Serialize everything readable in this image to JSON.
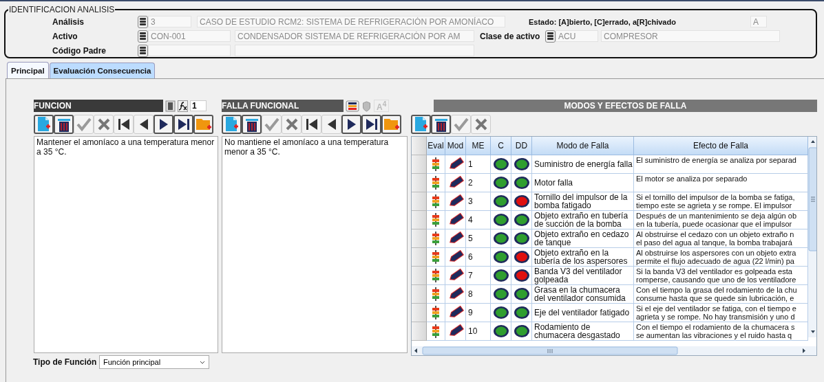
{
  "identificacion": {
    "title": "IDENTIFICACION ANALISIS",
    "analisis": {
      "label": "Análisis",
      "code": "3",
      "description": "CASO DE ESTUDIO RCM2: SISTEMA DE REFRIGERACIÓN POR AMONÍACO"
    },
    "estado": {
      "label": "Estado: [A]bierto, [C]errado, a[R]chivado",
      "value": "A"
    },
    "activo": {
      "label": "Activo",
      "code": "CON-001",
      "description": "CONDENSADOR SISTEMA DE REFRIGERACIÓN POR AM"
    },
    "clase_activo": {
      "label": "Clase de activo",
      "code": "ACU",
      "description": "COMPRESOR"
    },
    "codigo_padre": {
      "label": "Código Padre"
    }
  },
  "tabs": [
    {
      "label": "Principal",
      "selected": true
    },
    {
      "label": "Evaluación Consecuencia",
      "selected": false
    }
  ],
  "funcion": {
    "title": "FUNCION",
    "number": "1",
    "text": "Mantener el amoníaco a una temperatura menor a 35 °C.",
    "toolbar": [
      {
        "kind": "new",
        "disabled": false
      },
      {
        "kind": "delete",
        "disabled": false
      },
      {
        "kind": "save",
        "disabled": true
      },
      {
        "kind": "cancel",
        "disabled": true
      },
      {
        "kind": "first",
        "disabled": true
      },
      {
        "kind": "prev",
        "disabled": true
      },
      {
        "kind": "next",
        "disabled": false
      },
      {
        "kind": "last",
        "disabled": false
      },
      {
        "kind": "folder",
        "disabled": false
      }
    ],
    "tipo_label": "Tipo de Función",
    "tipo_value": "Función principal"
  },
  "falla_funcional": {
    "title": "FALLA FUNCIONAL",
    "letter": "A$^{4}$",
    "text": "No mantiene el amoníaco a una temperatura menor a 35 °C.",
    "toolbar": [
      {
        "kind": "new",
        "disabled": false
      },
      {
        "kind": "delete",
        "disabled": false
      },
      {
        "kind": "save",
        "disabled": true
      },
      {
        "kind": "cancel",
        "disabled": true
      },
      {
        "kind": "first",
        "disabled": true
      },
      {
        "kind": "prev",
        "disabled": true
      },
      {
        "kind": "next",
        "disabled": false
      },
      {
        "kind": "last",
        "disabled": false
      },
      {
        "kind": "folder",
        "disabled": false
      }
    ]
  },
  "modos": {
    "title": "MODOS Y EFECTOS DE FALLA",
    "toolbar": [
      {
        "kind": "new",
        "disabled": false
      },
      {
        "kind": "delete",
        "disabled": false
      },
      {
        "kind": "save",
        "disabled": true
      },
      {
        "kind": "cancel",
        "disabled": true
      }
    ],
    "columns": [
      "Eval",
      "Mod",
      "ME",
      "C",
      "DD",
      "Modo de Falla",
      "Efecto de Falla"
    ],
    "rows": [
      {
        "me": "1",
        "c": {
          "color": "#2f9e2f"
        },
        "dd": {
          "color": "#2f9e2f"
        },
        "modo": "Suministro de energía falla",
        "efecto": [
          "El suministro de energía se analiza por separad"
        ]
      },
      {
        "me": "2",
        "c": {
          "color": "#2f9e2f"
        },
        "dd": {
          "color": "#2f9e2f"
        },
        "modo": "Motor falla",
        "efecto": [
          "El motor se analiza por separado"
        ]
      },
      {
        "me": "3",
        "c": {
          "color": "#2f9e2f"
        },
        "dd": {
          "color": "#e01010"
        },
        "modo": "Tornillo del impulsor de la bomba fatigado",
        "efecto": [
          "Si el tornillo del impulsor de la bomba se fatiga,",
          "tiempo este se agrieta y se rompe. El impulsor"
        ]
      },
      {
        "me": "4",
        "c": {
          "color": "#2f9e2f"
        },
        "dd": {
          "color": "#2f9e2f"
        },
        "modo": "Objeto extraño en tubería de succión de la bomba",
        "efecto": [
          "Después de un mantenimiento se deja algún ob",
          "en la tubería, puede ocasionar que el impulsor"
        ]
      },
      {
        "me": "5",
        "c": {
          "color": "#2f9e2f"
        },
        "dd": {
          "color": "#2f9e2f"
        },
        "modo": "Objeto extraño en cedazo de tanque",
        "efecto": [
          "Al obstruirse el cedazo con un objeto extraño n",
          "el paso del agua al tanque, la bomba trabajará"
        ]
      },
      {
        "me": "6",
        "c": {
          "color": "#2f9e2f"
        },
        "dd": {
          "color": "#e01010"
        },
        "modo": "Objeto extraño en la tubería de los aspersores",
        "efecto": [
          "Al obstruirse los aspersores con un objeto extra",
          "permite el flujo adecuado de agua (22 l/min) pa"
        ]
      },
      {
        "me": "7",
        "c": {
          "color": "#2f9e2f"
        },
        "dd": {
          "color": "#e01010"
        },
        "modo": "Banda V3 del ventilador golpeada",
        "efecto": [
          "Si la banda V3 del ventilador es golpeada esta",
          "romperse, causando que uno de los ventiladore"
        ]
      },
      {
        "me": "8",
        "c": {
          "color": "#2f9e2f"
        },
        "dd": {
          "color": "#2f9e2f"
        },
        "modo": "Grasa en la chumacera del ventilador consumida",
        "efecto": [
          "Con el tiempo la grasa del rodamiento de la chu",
          "consume hasta que se quede sin lubricación, e"
        ]
      },
      {
        "me": "9",
        "c": {
          "color": "#2f9e2f"
        },
        "dd": {
          "color": "#2f9e2f"
        },
        "modo": "Eje del ventilador fatigado",
        "efecto": [
          "Si el eje del ventilador se fatiga, con el tiempo e",
          "agrieta y se rompe. No hay transmisión y uno d"
        ]
      },
      {
        "me": "10",
        "c": {
          "color": "#2f9e2f"
        },
        "dd": {
          "color": "#2f9e2f"
        },
        "modo": "Rodamiento de chumacera desgastado",
        "efecto": [
          "Con el tiempo el rodamiento de la chumacera s",
          "se aumentan las vibraciones y el  ruido hasta q"
        ]
      }
    ]
  }
}
